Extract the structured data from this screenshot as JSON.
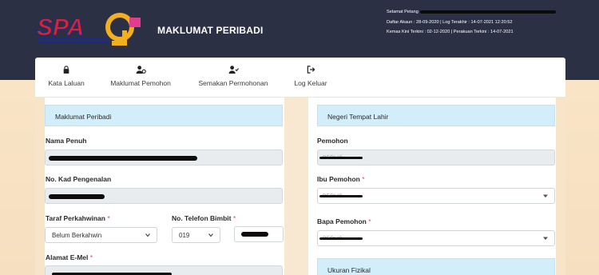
{
  "header": {
    "logo_text": "SPA9",
    "logo_subtext": "SISTEM APLIKASI PENGAMBILAN PERJAWATAN",
    "title": "MAKLUMAT PERIBADI",
    "greeting": "Selamat Petang",
    "daftar_line": "Daftar Akaun : 28-09-2020 | Log Terakhir : 14-07-2021 12:20:52",
    "kemas_line": "Kemas Kini Terkini : 02-12-2020 | Perakuan Terkini : 14-07-2021"
  },
  "tabs": [
    {
      "label": "Kata Laluan",
      "icon": "lock-icon"
    },
    {
      "label": "Maklumat Pemohon",
      "icon": "user-gear-icon"
    },
    {
      "label": "Semakan Permohonan",
      "icon": "user-check-icon"
    },
    {
      "label": "Log Keluar",
      "icon": "logout-icon"
    }
  ],
  "left": {
    "section_title": "Maklumat Peribadi",
    "nama_label": "Nama Penuh",
    "ic_label": "No. Kad Pengenalan",
    "taraf_label": "Taraf Perkahwinan",
    "taraf_value": "Belum Berkahwin",
    "telefon_label": "No. Telefon Bimbit",
    "telefon_prefix": "019",
    "email_label": "Alamat E-Mel"
  },
  "right": {
    "section_title": "Negeri Tempat Lahir",
    "pemohon_label": "Pemohon",
    "pemohon_value": "PERLIS",
    "ibu_label": "Ibu Pemohon",
    "ibu_value": "PERLIS",
    "bapa_label": "Bapa Pemohon",
    "bapa_value": "PERLIS",
    "section2_title": "Ukuran Fizikal"
  },
  "required_mark": "*",
  "colors": {
    "topbar": "#2b3045",
    "section_bg": "#d2eefa",
    "required": "#e8436e"
  }
}
